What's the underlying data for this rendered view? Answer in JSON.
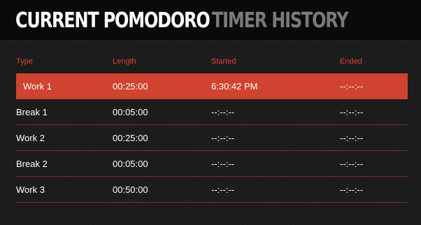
{
  "tabs": {
    "current_label": "CURRENT POMODORO",
    "history_label": "TIMER HISTORY"
  },
  "table": {
    "headers": [
      "Type",
      "Length",
      "Started",
      "Ended"
    ],
    "rows": [
      {
        "type": "Work 1",
        "length": "00:25:00",
        "started": "6:30:42 PM",
        "ended": "--:--:--",
        "active": true
      },
      {
        "type": "Break 1",
        "length": "00:05:00",
        "started": "--:--:--",
        "ended": "--:--:--",
        "active": false
      },
      {
        "type": "Work 2",
        "length": "00:25:00",
        "started": "--:--:--",
        "ended": "--:--:--",
        "active": false
      },
      {
        "type": "Break 2",
        "length": "00:05:00",
        "started": "--:--:--",
        "ended": "--:--:--",
        "active": false
      },
      {
        "type": "Work 3",
        "length": "00:50:00",
        "started": "--:--:--",
        "ended": "--:--:--",
        "active": false
      }
    ]
  },
  "colors": {
    "accent": "#cf4330",
    "header_text": "#d9432f",
    "inactive_tab": "#7a7a7a"
  }
}
